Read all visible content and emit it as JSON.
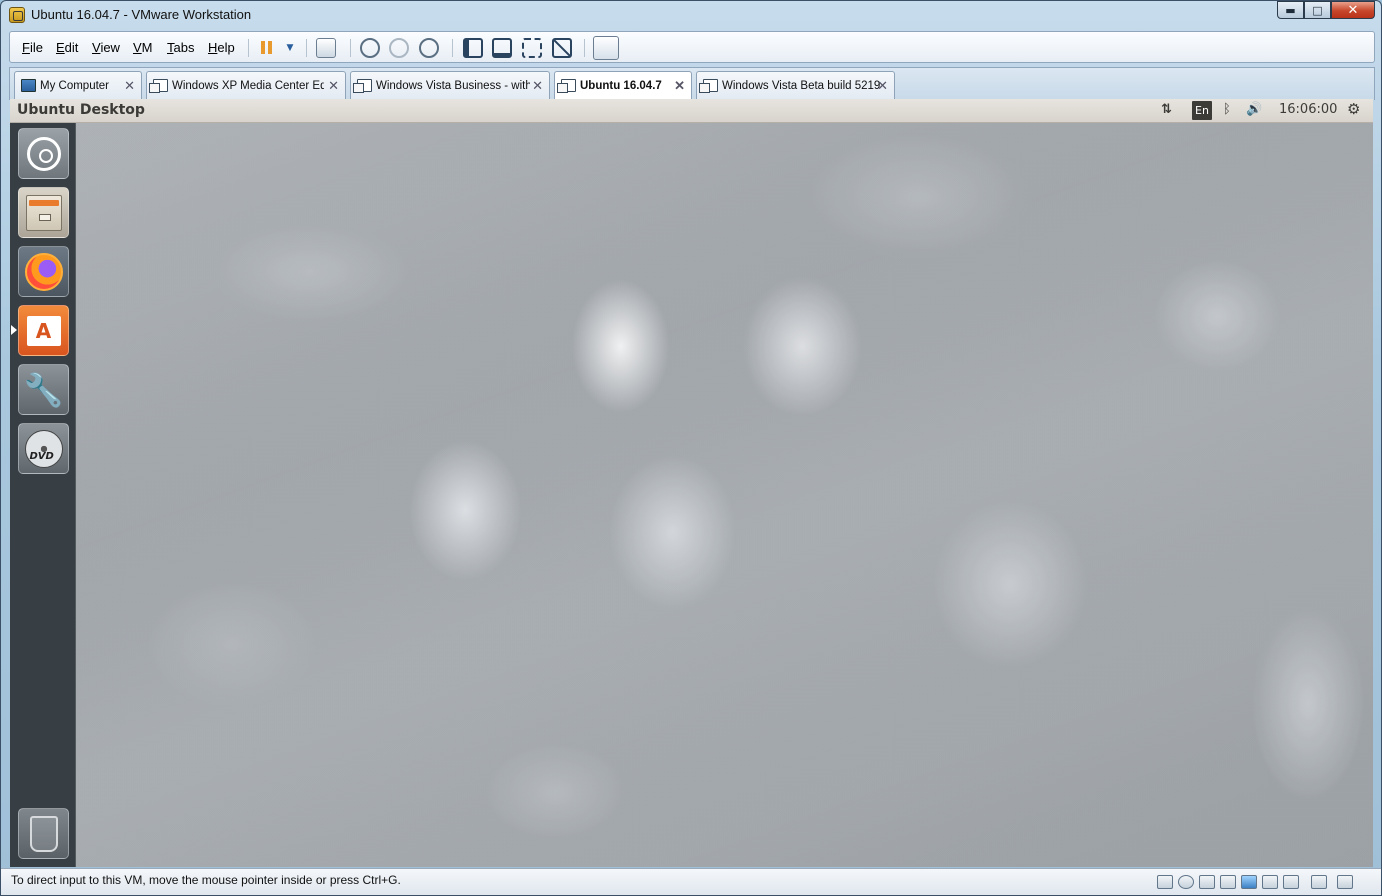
{
  "window": {
    "title": "Ubuntu 16.04.7 - VMware Workstation",
    "min_glyph": "▬",
    "max_glyph": "□",
    "close_glyph": "✕"
  },
  "menu": {
    "file": "File",
    "edit": "Edit",
    "view": "View",
    "vm": "VM",
    "tabs": "Tabs",
    "help": "Help"
  },
  "toolbar": {
    "icons": [
      "pause-icon",
      "dropdown-arrow-icon",
      "send-ctrl-alt-del-icon",
      "snapshot-take-icon",
      "snapshot-revert-icon",
      "snapshot-manager-icon",
      "console-view-icon",
      "full-screen-icon",
      "unity-icon",
      "stretch-guest-icon",
      "thumbnail-bar-icon"
    ]
  },
  "tabs": [
    {
      "label": "My Computer",
      "close": "✕"
    },
    {
      "label": "Windows XP Media Center Edi...",
      "close": "✕"
    },
    {
      "label": "Windows Vista Business - with...",
      "close": "✕"
    },
    {
      "label": "Ubuntu 16.04.7",
      "close": "✕"
    },
    {
      "label": "Windows Vista Beta build 5219",
      "close": "✕"
    }
  ],
  "ubuntu": {
    "panel_title": "Ubuntu Desktop",
    "network_glyph": "⇅",
    "keyboard_layout": "En",
    "bluetooth_glyph": "ᛒ",
    "volume_glyph": "🔊",
    "clock": "16:06:00",
    "settings_glyph": "⚙"
  },
  "launcher": {
    "items": [
      "dash-home",
      "files",
      "firefox",
      "ubuntu-software",
      "system-settings",
      "dvd",
      "trash"
    ],
    "software_glyph": "A",
    "settings_glyph": "🔧",
    "dvd_label": "DVD"
  },
  "status": {
    "message": "To direct input to this VM, move the mouse pointer inside or press Ctrl+G."
  },
  "colors": {
    "accent_orange": "#e89a2e",
    "ubuntu_panel": "#dad6cf",
    "launcher_bg": "#3c464e"
  }
}
